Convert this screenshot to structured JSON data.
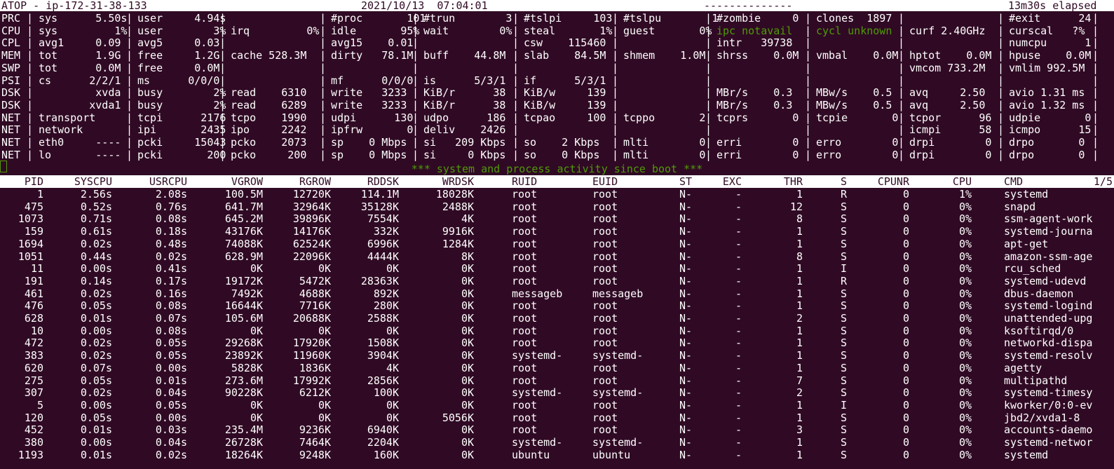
{
  "topbar": {
    "title": "ATOP - ip-172-31-38-133",
    "datetime": "2021/10/13  07:04:01",
    "dashes": "--------------",
    "elapsed": "13m30s elapsed"
  },
  "system_rows": [
    {
      "label": "PRC",
      "cells": [
        "sys      5.50s",
        "user     4.94s",
        "",
        "#proc       101",
        "#trun        3",
        "#tslpi     103",
        "#tslpu        1",
        "#zombie     0",
        "clones  1897",
        "",
        "#exit      24"
      ]
    },
    {
      "label": "CPU",
      "cells": [
        "sys         1%",
        "user        3%",
        "irq         0%",
        "idle       95%",
        "wait        0%",
        "steal       1%",
        "guest       0%",
        "ipc notavail",
        "cycl unknown",
        "curf 2.40GHz",
        "curscal   ?%"
      ],
      "green": [
        7,
        8
      ]
    },
    {
      "label": "CPL",
      "cells": [
        "avg1     0.09",
        "avg5     0.03",
        "",
        "avg15    0.01",
        "",
        "csw    115460",
        "",
        "intr   39738",
        "",
        "",
        "numcpu      1"
      ]
    },
    {
      "label": "MEM",
      "cells": [
        "tot      1.9G",
        "free     1.2G",
        "cache 528.3M",
        "dirty   78.1M",
        "buff    44.8M",
        "slab    84.5M",
        "shmem    1.0M",
        "shrss    0.0M",
        "vmbal    0.0M",
        "hptot    0.0M",
        "hpuse    0.0M"
      ]
    },
    {
      "label": "SWP",
      "cells": [
        "tot      0.0M",
        "free     0.0M",
        "",
        "",
        "",
        "",
        "",
        "",
        "",
        "vmcom 733.2M",
        "vmlim 992.5M"
      ]
    },
    {
      "label": "PSI",
      "cells": [
        "cs      2/2/1",
        "ms      0/0/0",
        "",
        "mf      0/0/0",
        "is      5/3/1",
        "if      5/3/1",
        "",
        "",
        "",
        "",
        ""
      ]
    },
    {
      "label": "DSK",
      "cells": [
        "         xvda",
        "busy        2%",
        "read    6310",
        "write   3233",
        "KiB/r      38",
        "KiB/w     139",
        "",
        "MBr/s    0.3",
        "MBw/s    0.5",
        "avq     2.50",
        "avio 1.31 ms"
      ]
    },
    {
      "label": "DSK",
      "cells": [
        "        xvda1",
        "busy        2%",
        "read    6289",
        "write   3233",
        "KiB/r      38",
        "KiB/w     139",
        "",
        "MBr/s    0.3",
        "MBw/s    0.5",
        "avq     2.50",
        "avio 1.32 ms"
      ]
    },
    {
      "label": "NET",
      "cells": [
        "transport",
        "tcpi      2176",
        "tcpo    1990",
        "udpi      130",
        "udpo      186",
        "tcpao     100",
        "tcppo       2",
        "tcprs       0",
        "tcpie       0",
        "tcpor      96",
        "udpie       0"
      ]
    },
    {
      "label": "NET",
      "cells": [
        "network",
        "ipi       2435",
        "ipo     2242",
        "ipfrw       0",
        "deliv    2426",
        "",
        "",
        "",
        "",
        "icmpi      58",
        "icmpo      15"
      ]
    },
    {
      "label": "NET",
      "cells": [
        "eth0     ----",
        "pcki     15043",
        "pcko    2073",
        "sp    0 Mbps",
        "si   209 Kbps",
        "so    2 Kbps",
        "mlti        0",
        "erri        0",
        "erro        0",
        "drpi        0",
        "drpo       0"
      ]
    },
    {
      "label": "NET",
      "cells": [
        "lo       ----",
        "pcki       200",
        "pcko     200",
        "sp    0 Mbps",
        "si     0 Kbps",
        "so    0 Kbps",
        "mlti        0",
        "erri        0",
        "erro        0",
        "drpi        0",
        "drpo       0"
      ]
    }
  ],
  "banner": "*** system and process activity since boot ***",
  "process_table": {
    "columns": [
      "PID",
      "SYSCPU",
      "USRCPU",
      "VGROW",
      "RGROW",
      "RDDSK",
      "WRDSK",
      "RUID",
      "EUID",
      "ST",
      "EXC",
      "THR",
      "S",
      "CPUNR",
      "CPU",
      "CMD"
    ],
    "page": "1/5",
    "rows": [
      [
        "1",
        "2.56s",
        "2.08s",
        "100.5M",
        "12720K",
        "114.1M",
        "18028K",
        "root",
        "root",
        "N-",
        "-",
        "1",
        "R",
        "0",
        "1%",
        "systemd"
      ],
      [
        "475",
        "0.52s",
        "0.76s",
        "641.7M",
        "32964K",
        "35128K",
        "2488K",
        "root",
        "root",
        "N-",
        "-",
        "12",
        "S",
        "0",
        "0%",
        "snapd"
      ],
      [
        "1073",
        "0.71s",
        "0.08s",
        "645.2M",
        "39896K",
        "7554K",
        "4K",
        "root",
        "root",
        "N-",
        "-",
        "8",
        "S",
        "0",
        "0%",
        "ssm-agent-work"
      ],
      [
        "159",
        "0.61s",
        "0.18s",
        "43176K",
        "14176K",
        "332K",
        "9916K",
        "root",
        "root",
        "N-",
        "-",
        "1",
        "S",
        "0",
        "0%",
        "systemd-journa"
      ],
      [
        "1694",
        "0.02s",
        "0.48s",
        "74088K",
        "62524K",
        "6996K",
        "1284K",
        "root",
        "root",
        "N-",
        "-",
        "1",
        "S",
        "0",
        "0%",
        "apt-get"
      ],
      [
        "1051",
        "0.44s",
        "0.02s",
        "628.9M",
        "22096K",
        "4444K",
        "8K",
        "root",
        "root",
        "N-",
        "-",
        "8",
        "S",
        "0",
        "0%",
        "amazon-ssm-age"
      ],
      [
        "11",
        "0.00s",
        "0.41s",
        "0K",
        "0K",
        "0K",
        "0K",
        "root",
        "root",
        "N-",
        "-",
        "1",
        "I",
        "0",
        "0%",
        "rcu_sched"
      ],
      [
        "191",
        "0.14s",
        "0.17s",
        "19172K",
        "5472K",
        "28363K",
        "0K",
        "root",
        "root",
        "N-",
        "-",
        "1",
        "R",
        "0",
        "0%",
        "systemd-udevd"
      ],
      [
        "461",
        "0.02s",
        "0.16s",
        "7492K",
        "4688K",
        "892K",
        "0K",
        "messageb",
        "messageb",
        "N-",
        "-",
        "1",
        "S",
        "0",
        "0%",
        "dbus-daemon"
      ],
      [
        "476",
        "0.05s",
        "0.08s",
        "16644K",
        "7716K",
        "280K",
        "0K",
        "root",
        "root",
        "N-",
        "-",
        "1",
        "S",
        "0",
        "0%",
        "systemd-logind"
      ],
      [
        "628",
        "0.01s",
        "0.07s",
        "105.6M",
        "20688K",
        "2588K",
        "0K",
        "root",
        "root",
        "N-",
        "-",
        "2",
        "S",
        "0",
        "0%",
        "unattended-upg"
      ],
      [
        "10",
        "0.00s",
        "0.08s",
        "0K",
        "0K",
        "0K",
        "0K",
        "root",
        "root",
        "N-",
        "-",
        "1",
        "S",
        "0",
        "0%",
        "ksoftirqd/0"
      ],
      [
        "472",
        "0.02s",
        "0.05s",
        "29268K",
        "17920K",
        "1508K",
        "0K",
        "root",
        "root",
        "N-",
        "-",
        "1",
        "S",
        "0",
        "0%",
        "networkd-dispa"
      ],
      [
        "383",
        "0.02s",
        "0.05s",
        "23892K",
        "11960K",
        "3904K",
        "0K",
        "systemd-",
        "systemd-",
        "N-",
        "-",
        "1",
        "S",
        "0",
        "0%",
        "systemd-resolv"
      ],
      [
        "620",
        "0.07s",
        "0.00s",
        "5828K",
        "1836K",
        "4K",
        "0K",
        "root",
        "root",
        "N-",
        "-",
        "1",
        "S",
        "0",
        "0%",
        "agetty"
      ],
      [
        "275",
        "0.05s",
        "0.01s",
        "273.6M",
        "17992K",
        "2856K",
        "0K",
        "root",
        "root",
        "N-",
        "-",
        "7",
        "S",
        "0",
        "0%",
        "multipathd"
      ],
      [
        "307",
        "0.02s",
        "0.04s",
        "90228K",
        "6212K",
        "100K",
        "0K",
        "systemd-",
        "systemd-",
        "N-",
        "-",
        "2",
        "S",
        "0",
        "0%",
        "systemd-timesy"
      ],
      [
        "5",
        "0.00s",
        "0.05s",
        "0K",
        "0K",
        "0K",
        "0K",
        "root",
        "root",
        "N-",
        "-",
        "1",
        "I",
        "0",
        "0%",
        "kworker/0:0-ev"
      ],
      [
        "120",
        "0.05s",
        "0.00s",
        "0K",
        "0K",
        "0K",
        "5056K",
        "root",
        "root",
        "N-",
        "-",
        "1",
        "S",
        "0",
        "0%",
        "jbd2/xvda1-8"
      ],
      [
        "452",
        "0.01s",
        "0.03s",
        "235.4M",
        "9236K",
        "6940K",
        "0K",
        "root",
        "root",
        "N-",
        "-",
        "3",
        "S",
        "0",
        "0%",
        "accounts-daemo"
      ],
      [
        "380",
        "0.00s",
        "0.04s",
        "26728K",
        "7464K",
        "2204K",
        "0K",
        "systemd-",
        "systemd-",
        "N-",
        "-",
        "1",
        "S",
        "0",
        "0%",
        "systemd-networ"
      ],
      [
        "1193",
        "0.01s",
        "0.02s",
        "18264K",
        "9248K",
        "160K",
        "0K",
        "ubuntu",
        "ubuntu",
        "N-",
        "-",
        "1",
        "S",
        "0",
        "0%",
        "systemd"
      ]
    ]
  }
}
